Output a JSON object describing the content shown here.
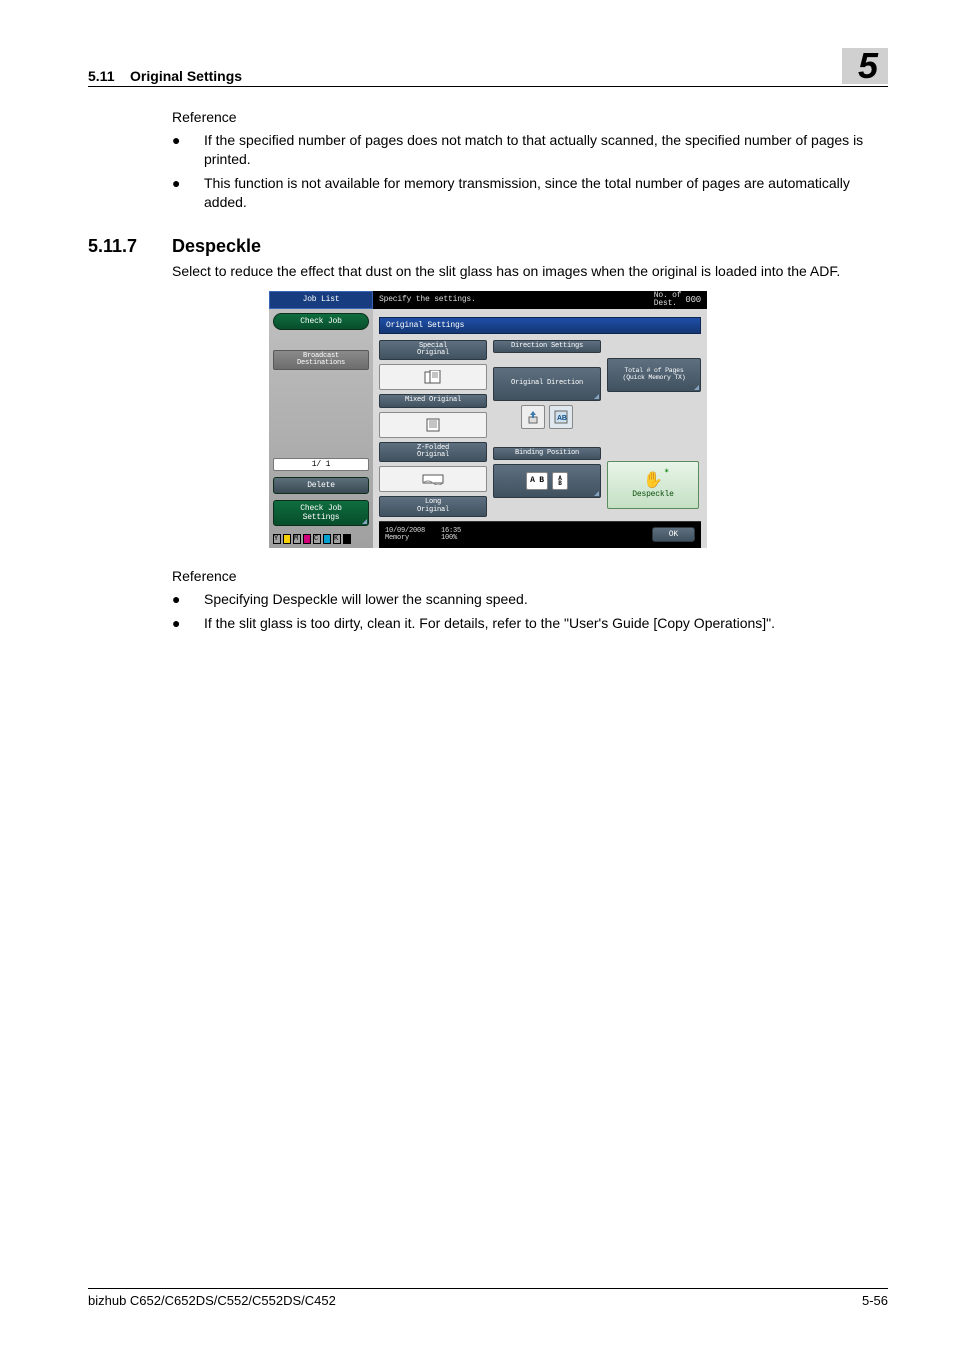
{
  "header": {
    "section_num": "5.11",
    "section_title": "Original Settings",
    "chapter": "5"
  },
  "block1": {
    "reference_label": "Reference",
    "bullets": [
      "If the specified number of pages does not match to that actually scanned, the specified number of pages is printed.",
      "This function is not available for memory transmission, since the total number of pages are automatically added."
    ]
  },
  "subsection": {
    "num": "5.11.7",
    "title": "Despeckle",
    "desc": "Select to reduce the effect that dust on the slit glass has on images when the original is loaded into the ADF."
  },
  "screenshot": {
    "job_list": "Job List",
    "specify": "Specify the settings.",
    "dest_label": "No. of\nDest.",
    "dest_val": "000",
    "check_job": "Check Job",
    "broadcast": "Broadcast\nDestinations",
    "pager": "1/   1",
    "delete": "Delete",
    "check_job_settings": "Check Job\nSettings",
    "panel_title": "Original Settings",
    "special_original": "Special\nOriginal",
    "mixed_original": "Mixed Original",
    "z_folded": "Z-Folded\nOriginal",
    "long_original": "Long\nOriginal",
    "direction_settings": "Direction Settings",
    "original_direction": "Original Direction",
    "binding_position": "Binding Position",
    "total_pages": "Total # of Pages\n(Quick Memory TX)",
    "despeckle": "Despeckle",
    "date": "10/09/2008",
    "time": "16:35",
    "memory": "Memory",
    "mem_pct": "100%",
    "ok": "OK"
  },
  "block2": {
    "reference_label": "Reference",
    "bullets": [
      "Specifying Despeckle will lower the scanning speed.",
      "If the slit glass is too dirty, clean it. For details, refer to the \"User's Guide [Copy Operations]\"."
    ]
  },
  "footer": {
    "product": "bizhub C652/C652DS/C552/C552DS/C452",
    "page": "5-56"
  }
}
